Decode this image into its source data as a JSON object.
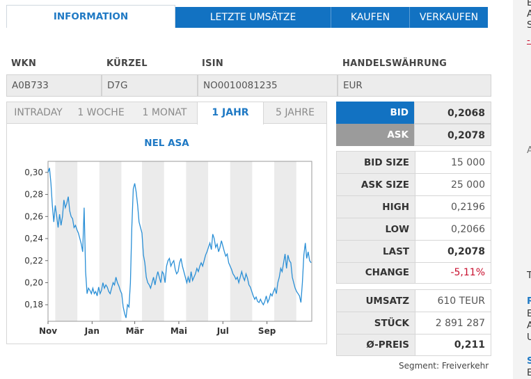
{
  "tabs": {
    "information": "INFORMATION",
    "letzte_umsaetze": "LETZTE UMSÄTZE",
    "kaufen": "KAUFEN",
    "verkaufen": "VERKAUFEN"
  },
  "codes": {
    "headers": [
      "WKN",
      "KÜRZEL",
      "ISIN",
      "HANDELSWÄHRUNG"
    ],
    "values": [
      "A0B733",
      "D7G",
      "NO0010081235",
      "EUR"
    ]
  },
  "chart_tabs": [
    "INTRADAY",
    "1 WOCHE",
    "1 MONAT",
    "1 JAHR",
    "5 JAHRE"
  ],
  "chart_data": {
    "type": "line",
    "title": "NEL ASA",
    "ylim": [
      0.165,
      0.31
    ],
    "y_ticks": [
      "0,30",
      "0,28",
      "0,26",
      "0,24",
      "0,22",
      "0,20",
      "0,18"
    ],
    "y_tick_values": [
      0.3,
      0.28,
      0.26,
      0.24,
      0.22,
      0.2,
      0.18
    ],
    "x_ticks": [
      "Nov",
      "Jan",
      "Mär",
      "Mai",
      "Jul",
      "Sep"
    ],
    "x_tick_positions": [
      0,
      61,
      120,
      181,
      242,
      303
    ],
    "x_range": [
      0,
      365
    ],
    "grid": "vertical month bands",
    "series": [
      {
        "values": [
          [
            0,
            0.3
          ],
          [
            2,
            0.304
          ],
          [
            4,
            0.29
          ],
          [
            6,
            0.27
          ],
          [
            8,
            0.255
          ],
          [
            10,
            0.27
          ],
          [
            12,
            0.26
          ],
          [
            14,
            0.25
          ],
          [
            16,
            0.262
          ],
          [
            18,
            0.252
          ],
          [
            20,
            0.26
          ],
          [
            22,
            0.275
          ],
          [
            24,
            0.268
          ],
          [
            26,
            0.272
          ],
          [
            28,
            0.278
          ],
          [
            30,
            0.265
          ],
          [
            32,
            0.26
          ],
          [
            34,
            0.258
          ],
          [
            36,
            0.25
          ],
          [
            38,
            0.252
          ],
          [
            40,
            0.248
          ],
          [
            42,
            0.245
          ],
          [
            44,
            0.24
          ],
          [
            46,
            0.235
          ],
          [
            48,
            0.228
          ],
          [
            50,
            0.268
          ],
          [
            52,
            0.21
          ],
          [
            54,
            0.19
          ],
          [
            56,
            0.195
          ],
          [
            58,
            0.193
          ],
          [
            60,
            0.19
          ],
          [
            62,
            0.195
          ],
          [
            64,
            0.19
          ],
          [
            66,
            0.192
          ],
          [
            68,
            0.188
          ],
          [
            70,
            0.196
          ],
          [
            72,
            0.19
          ],
          [
            74,
            0.193
          ],
          [
            76,
            0.2
          ],
          [
            78,
            0.195
          ],
          [
            80,
            0.198
          ],
          [
            82,
            0.196
          ],
          [
            84,
            0.192
          ],
          [
            86,
            0.19
          ],
          [
            88,
            0.195
          ],
          [
            90,
            0.2
          ],
          [
            92,
            0.198
          ],
          [
            94,
            0.205
          ],
          [
            96,
            0.2
          ],
          [
            98,
            0.197
          ],
          [
            100,
            0.193
          ],
          [
            102,
            0.19
          ],
          [
            104,
            0.178
          ],
          [
            106,
            0.172
          ],
          [
            108,
            0.168
          ],
          [
            110,
            0.18
          ],
          [
            112,
            0.178
          ],
          [
            114,
            0.2
          ],
          [
            116,
            0.25
          ],
          [
            118,
            0.285
          ],
          [
            120,
            0.29
          ],
          [
            122,
            0.282
          ],
          [
            124,
            0.27
          ],
          [
            126,
            0.255
          ],
          [
            128,
            0.25
          ],
          [
            130,
            0.245
          ],
          [
            132,
            0.225
          ],
          [
            134,
            0.218
          ],
          [
            136,
            0.205
          ],
          [
            138,
            0.2
          ],
          [
            140,
            0.198
          ],
          [
            142,
            0.195
          ],
          [
            144,
            0.2
          ],
          [
            146,
            0.205
          ],
          [
            148,
            0.198
          ],
          [
            150,
            0.205
          ],
          [
            152,
            0.21
          ],
          [
            154,
            0.205
          ],
          [
            156,
            0.2
          ],
          [
            158,
            0.21
          ],
          [
            160,
            0.208
          ],
          [
            162,
            0.2
          ],
          [
            164,
            0.215
          ],
          [
            166,
            0.22
          ],
          [
            168,
            0.222
          ],
          [
            170,
            0.215
          ],
          [
            172,
            0.218
          ],
          [
            174,
            0.22
          ],
          [
            176,
            0.212
          ],
          [
            178,
            0.208
          ],
          [
            180,
            0.21
          ],
          [
            182,
            0.218
          ],
          [
            184,
            0.222
          ],
          [
            186,
            0.215
          ],
          [
            188,
            0.21
          ],
          [
            190,
            0.205
          ],
          [
            192,
            0.2
          ],
          [
            194,
            0.205
          ],
          [
            196,
            0.2
          ],
          [
            198,
            0.21
          ],
          [
            200,
            0.202
          ],
          [
            202,
            0.205
          ],
          [
            204,
            0.208
          ],
          [
            206,
            0.213
          ],
          [
            208,
            0.21
          ],
          [
            210,
            0.215
          ],
          [
            212,
            0.218
          ],
          [
            214,
            0.215
          ],
          [
            216,
            0.22
          ],
          [
            218,
            0.225
          ],
          [
            220,
            0.228
          ],
          [
            222,
            0.232
          ],
          [
            224,
            0.236
          ],
          [
            226,
            0.23
          ],
          [
            228,
            0.244
          ],
          [
            230,
            0.24
          ],
          [
            232,
            0.232
          ],
          [
            234,
            0.235
          ],
          [
            236,
            0.228
          ],
          [
            238,
            0.232
          ],
          [
            240,
            0.238
          ],
          [
            242,
            0.233
          ],
          [
            244,
            0.228
          ],
          [
            246,
            0.224
          ],
          [
            248,
            0.226
          ],
          [
            250,
            0.218
          ],
          [
            252,
            0.215
          ],
          [
            254,
            0.212
          ],
          [
            256,
            0.208
          ],
          [
            258,
            0.206
          ],
          [
            260,
            0.203
          ],
          [
            262,
            0.205
          ],
          [
            264,
            0.2
          ],
          [
            266,
            0.205
          ],
          [
            268,
            0.21
          ],
          [
            270,
            0.205
          ],
          [
            272,
            0.202
          ],
          [
            274,
            0.208
          ],
          [
            276,
            0.204
          ],
          [
            278,
            0.198
          ],
          [
            280,
            0.196
          ],
          [
            282,
            0.192
          ],
          [
            284,
            0.188
          ],
          [
            286,
            0.185
          ],
          [
            288,
            0.187
          ],
          [
            290,
            0.183
          ],
          [
            292,
            0.182
          ],
          [
            294,
            0.185
          ],
          [
            296,
            0.182
          ],
          [
            298,
            0.18
          ],
          [
            300,
            0.183
          ],
          [
            302,
            0.188
          ],
          [
            304,
            0.182
          ],
          [
            306,
            0.185
          ],
          [
            308,
            0.19
          ],
          [
            310,
            0.188
          ],
          [
            312,
            0.192
          ],
          [
            314,
            0.195
          ],
          [
            316,
            0.19
          ],
          [
            318,
            0.2
          ],
          [
            320,
            0.205
          ],
          [
            322,
            0.213
          ],
          [
            324,
            0.21
          ],
          [
            326,
            0.218
          ],
          [
            328,
            0.226
          ],
          [
            330,
            0.213
          ],
          [
            332,
            0.225
          ],
          [
            334,
            0.22
          ],
          [
            336,
            0.218
          ],
          [
            338,
            0.205
          ],
          [
            340,
            0.2
          ],
          [
            342,
            0.195
          ],
          [
            344,
            0.192
          ],
          [
            346,
            0.19
          ],
          [
            348,
            0.188
          ],
          [
            350,
            0.182
          ],
          [
            352,
            0.2
          ],
          [
            354,
            0.225
          ],
          [
            356,
            0.236
          ],
          [
            358,
            0.222
          ],
          [
            360,
            0.228
          ],
          [
            362,
            0.22
          ],
          [
            364,
            0.218
          ]
        ]
      }
    ]
  },
  "quote": {
    "bid": {
      "label": "BID",
      "value": "0,2068"
    },
    "ask": {
      "label": "ASK",
      "value": "0,2078"
    },
    "group1": [
      {
        "label": "BID SIZE",
        "value": "15 000"
      },
      {
        "label": "ASK SIZE",
        "value": "25 000"
      },
      {
        "label": "HIGH",
        "value": "0,2196"
      },
      {
        "label": "LOW",
        "value": "0,2066"
      },
      {
        "label": "LAST",
        "value": "0,2078"
      },
      {
        "label": "CHANGE",
        "value": "-5,11%"
      }
    ],
    "group2": [
      {
        "label": "UMSATZ",
        "value": "610 TEUR"
      },
      {
        "label": "STÜCK",
        "value": "2 891 287"
      },
      {
        "label": "Ø-PREIS",
        "value": "0,211"
      }
    ],
    "segment": "Segment: Freiverkehr"
  },
  "sidebar": {
    "t1": "E",
    "t2": "A",
    "t3": "S",
    "t4": "-",
    "t5": "A",
    "t6": "T",
    "t7": "R",
    "t8": "E",
    "t9": "A",
    "t10": "U",
    "t11": "S",
    "t12": "E"
  },
  "colors": {
    "accent": "#1272c2",
    "negative": "#c8102e",
    "line": "#2a8fd6"
  }
}
